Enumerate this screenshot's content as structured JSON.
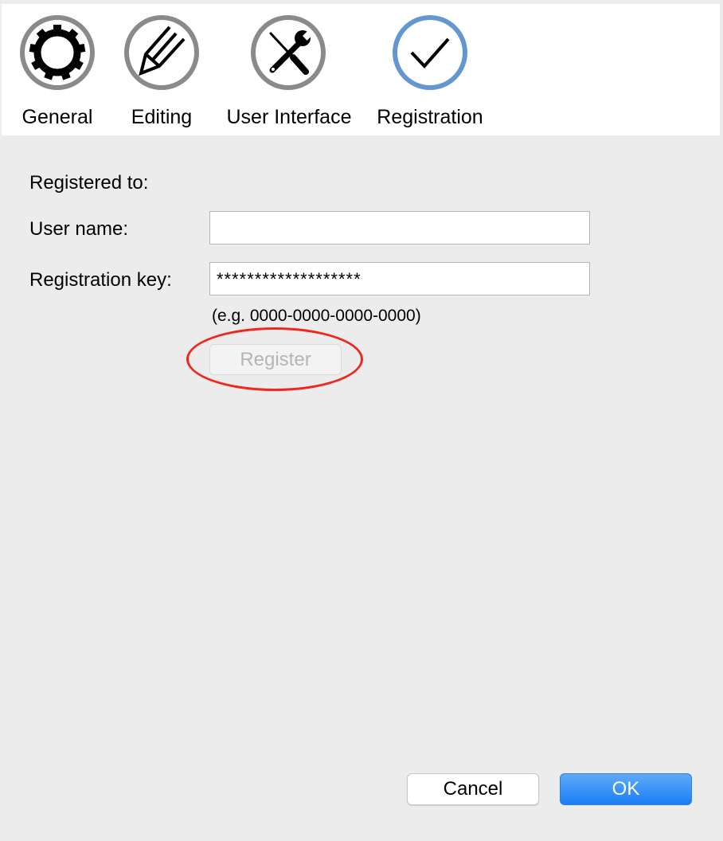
{
  "toolbar": {
    "tabs": [
      {
        "label": "General",
        "icon": "gear-icon"
      },
      {
        "label": "Editing",
        "icon": "pencil-icon"
      },
      {
        "label": "User Interface",
        "icon": "tools-icon"
      },
      {
        "label": "Registration",
        "icon": "checkmark-icon",
        "selected": true
      }
    ]
  },
  "registration": {
    "registered_to_label": "Registered to:",
    "user_name_label": "User name:",
    "user_name_value": "",
    "key_label": "Registration key:",
    "key_value": "*******************",
    "key_hint": "(e.g. 0000-0000-0000-0000)",
    "register_button": "Register",
    "register_enabled": false
  },
  "footer": {
    "cancel": "Cancel",
    "ok": "OK"
  },
  "colors": {
    "selected_ring": "#6497cf",
    "ring": "#8a8a8a",
    "annotation": "#f0271d",
    "ok_button": "#1b7ef6"
  }
}
